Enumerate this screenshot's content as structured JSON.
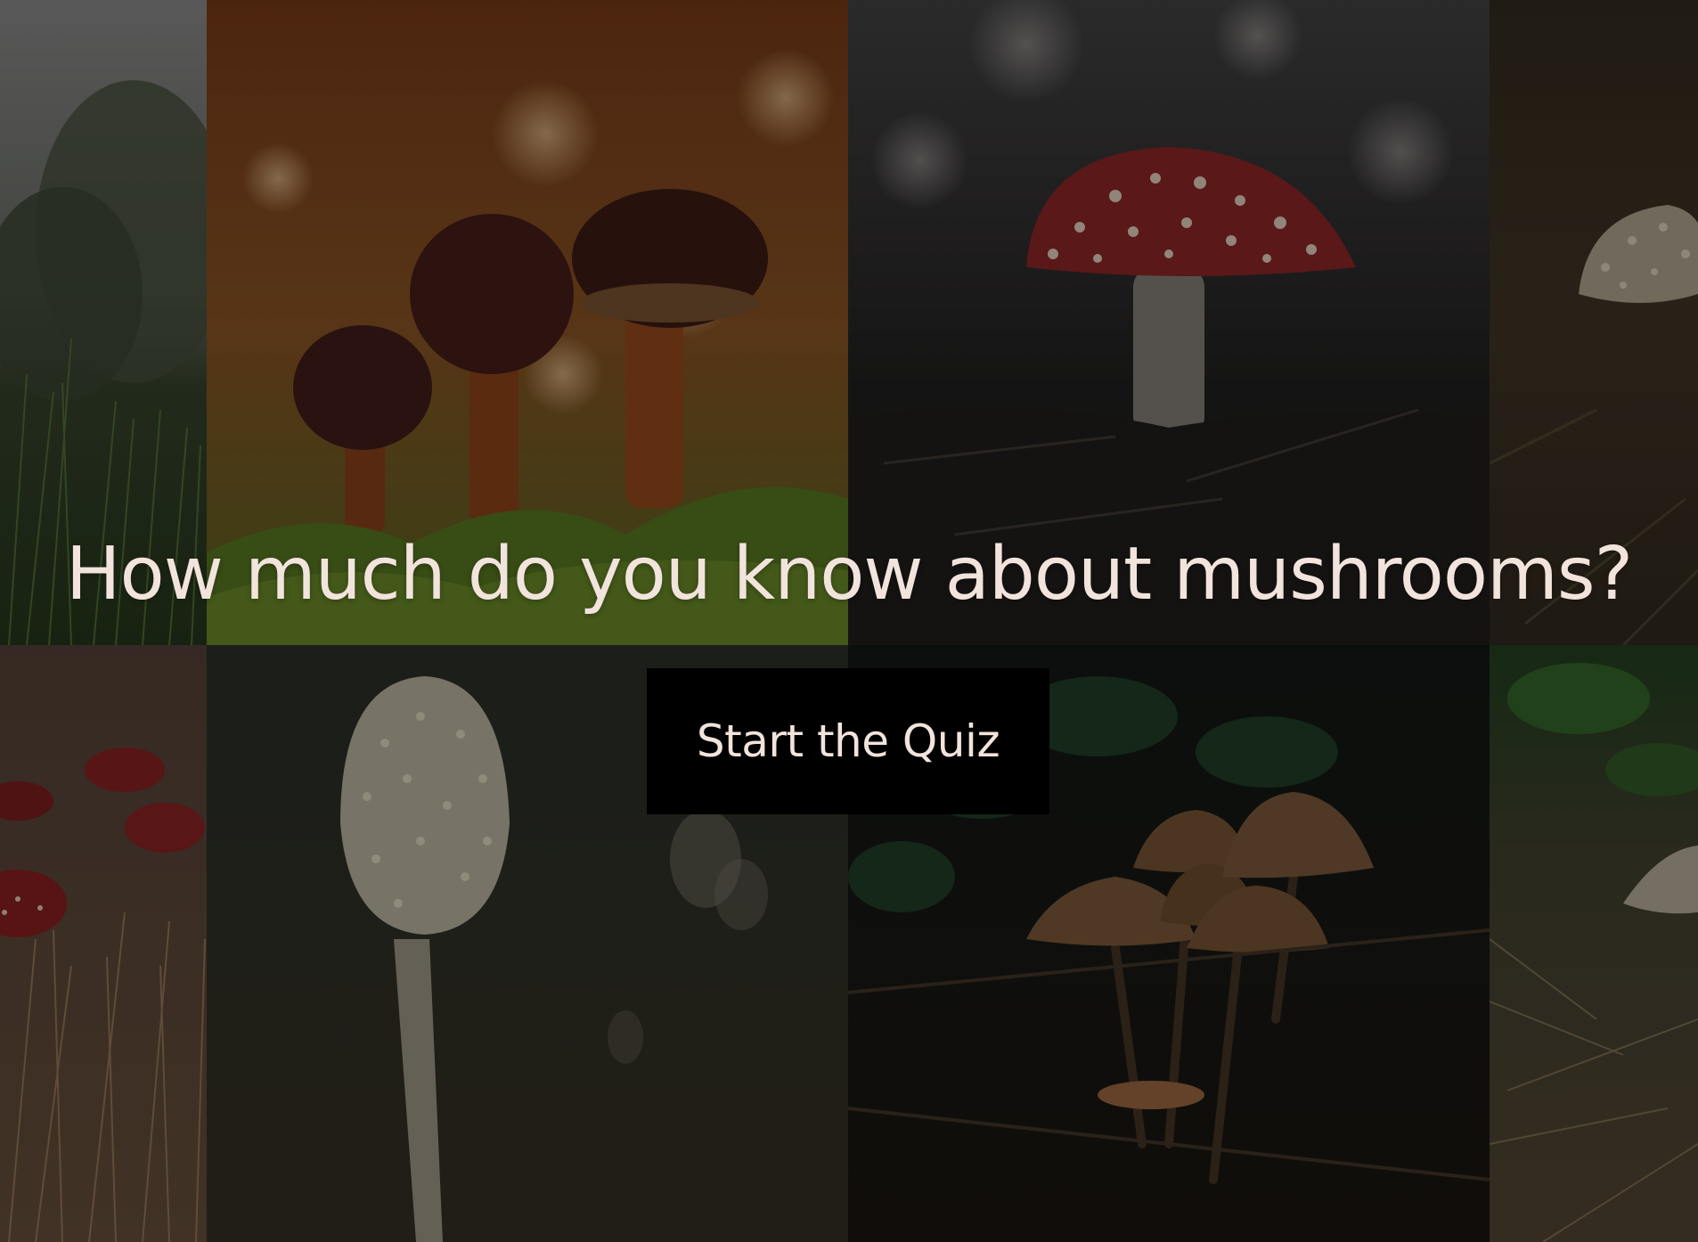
{
  "hero": {
    "title": "How much do you know about mushrooms?",
    "start_button_label": "Start the Quiz"
  },
  "colors": {
    "title_text": "#f2e4dd",
    "button_bg": "#000000",
    "button_text": "#f2e4dd"
  },
  "background_tiles": [
    {
      "name": "meadow-grass-photo"
    },
    {
      "name": "brown-bolete-mushrooms-photo"
    },
    {
      "name": "fly-agaric-red-mushroom-photo"
    },
    {
      "name": "white-scaly-mushroom-photo"
    },
    {
      "name": "red-mushrooms-in-dry-grass-photo"
    },
    {
      "name": "shaggy-ink-cap-mushroom-photo"
    },
    {
      "name": "brown-mushroom-cluster-photo"
    },
    {
      "name": "pale-mushroom-in-grass-photo"
    }
  ]
}
